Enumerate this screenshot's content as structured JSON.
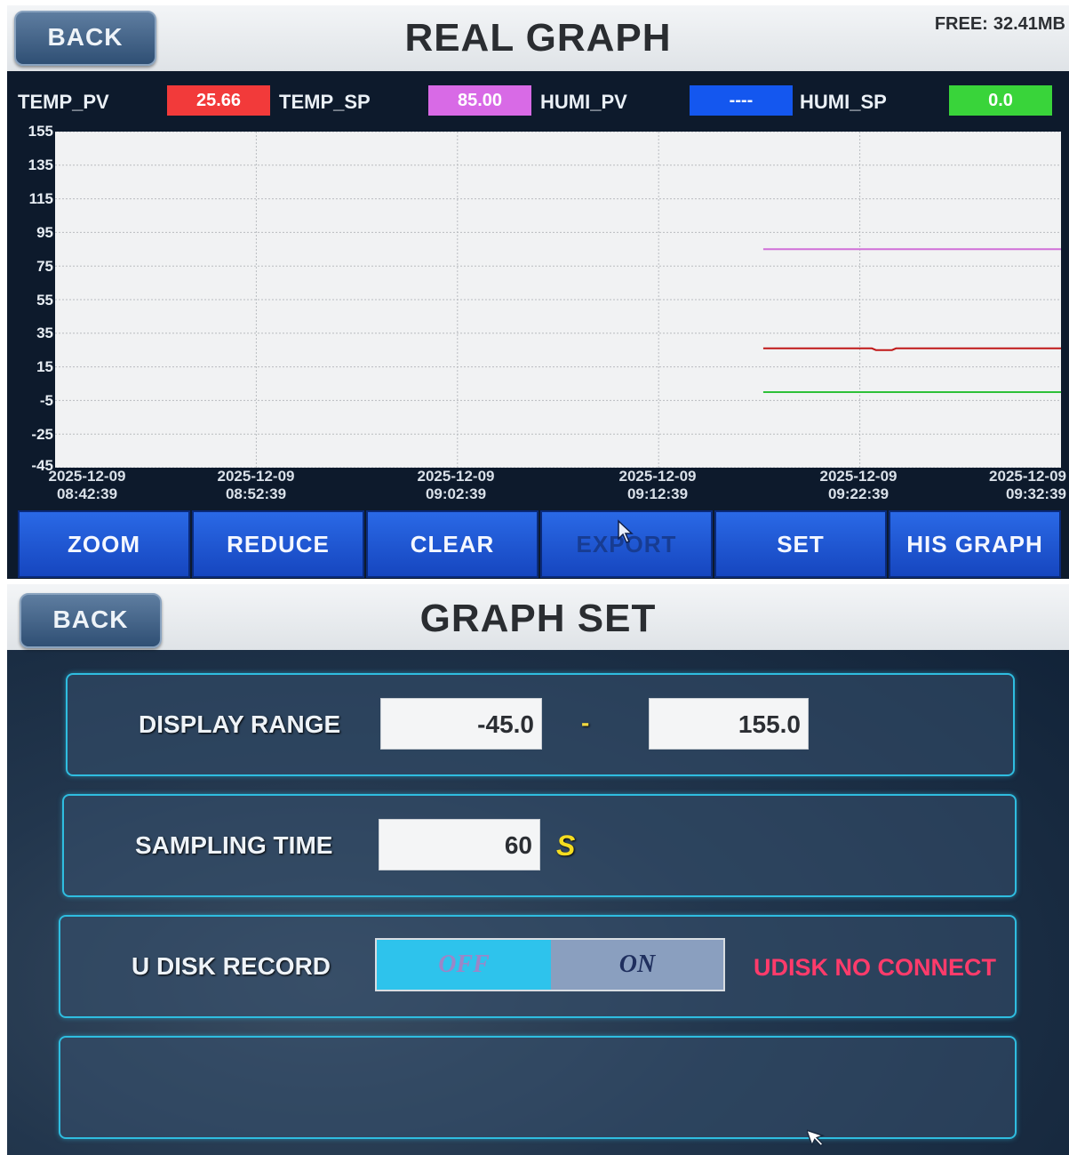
{
  "real_graph": {
    "back_label": "BACK",
    "title": "REAL GRAPH",
    "free_label": "FREE:",
    "free_value": "32.41MB",
    "status": [
      {
        "label": "TEMP_PV",
        "value": "25.66",
        "color": "#f23a3a"
      },
      {
        "label": "TEMP_SP",
        "value": "85.00",
        "color": "#d86ae6"
      },
      {
        "label": "HUMI_PV",
        "value": "----",
        "color": "#1457ef"
      },
      {
        "label": "HUMI_SP",
        "value": "0.0",
        "color": "#39d43a"
      }
    ],
    "y_ticks": [
      "155",
      "135",
      "115",
      "95",
      "75",
      "55",
      "35",
      "15",
      "-5",
      "-25",
      "-45"
    ],
    "x_ticks": [
      {
        "date": "2025-12-09",
        "time": "08:42:39"
      },
      {
        "date": "2025-12-09",
        "time": "08:52:39"
      },
      {
        "date": "2025-12-09",
        "time": "09:02:39"
      },
      {
        "date": "2025-12-09",
        "time": "09:12:39"
      },
      {
        "date": "2025-12-09",
        "time": "09:22:39"
      },
      {
        "date": "2025-12-09",
        "time": "09:32:39"
      }
    ],
    "buttons": [
      "ZOOM",
      "REDUCE",
      "CLEAR",
      "EXPORT",
      "SET",
      "HIS GRAPH"
    ]
  },
  "chart_data": {
    "type": "line",
    "ylim": [
      -45,
      155
    ],
    "y_tick_values": [
      155,
      135,
      115,
      95,
      75,
      55,
      35,
      15,
      -5,
      -25,
      -45
    ],
    "x_tick_labels": [
      "2025-12-09 08:42:39",
      "2025-12-09 08:52:39",
      "2025-12-09 09:02:39",
      "2025-12-09 09:12:39",
      "2025-12-09 09:22:39",
      "2025-12-09 09:32:39"
    ],
    "x_range_minutes": [
      0,
      50
    ],
    "grid": true,
    "series": [
      {
        "color": "#d070d8",
        "points": [
          [
            35.2,
            85
          ],
          [
            50,
            85
          ]
        ]
      },
      {
        "color": "#c01818",
        "points": [
          [
            35.2,
            26
          ],
          [
            40.6,
            26
          ],
          [
            40.8,
            25
          ],
          [
            41.6,
            25
          ],
          [
            41.8,
            26
          ],
          [
            50,
            26
          ]
        ]
      },
      {
        "color": "#2ec038",
        "points": [
          [
            35.2,
            0
          ],
          [
            50,
            0
          ]
        ]
      }
    ]
  },
  "graph_set": {
    "back_label": "BACK",
    "title": "GRAPH SET",
    "display_range_label": "DISPLAY RANGE",
    "range_min": "-45.0",
    "range_sep": "-",
    "range_max": "155.0",
    "sampling_label": "SAMPLING TIME",
    "sampling_value": "60",
    "sampling_unit": "S",
    "udisk_label": "U DISK RECORD",
    "toggle_off": "OFF",
    "toggle_on": "ON",
    "udisk_status": "UDISK NO CONNECT"
  }
}
